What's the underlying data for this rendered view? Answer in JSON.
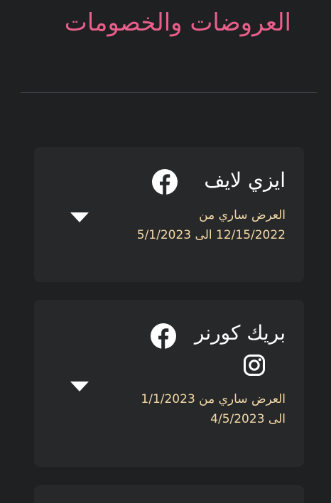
{
  "page": {
    "title": "العروضات والخصومات"
  },
  "colors": {
    "background": "#1f2022",
    "card": "#27282a",
    "title": "#e95f8a",
    "offer_text": "#f3d8a6"
  },
  "offers": [
    {
      "store": "ايزي لايف",
      "line1": "العرض ساري من",
      "line2": "12/15/2022 الى 5/1/2023",
      "icons": [
        "facebook-icon"
      ]
    },
    {
      "store": "بريك كورنر",
      "line1": "العرض ساري من 1/1/2023",
      "line2": "الى 4/5/2023",
      "icons": [
        "facebook-icon",
        "instagram-icon"
      ]
    }
  ]
}
